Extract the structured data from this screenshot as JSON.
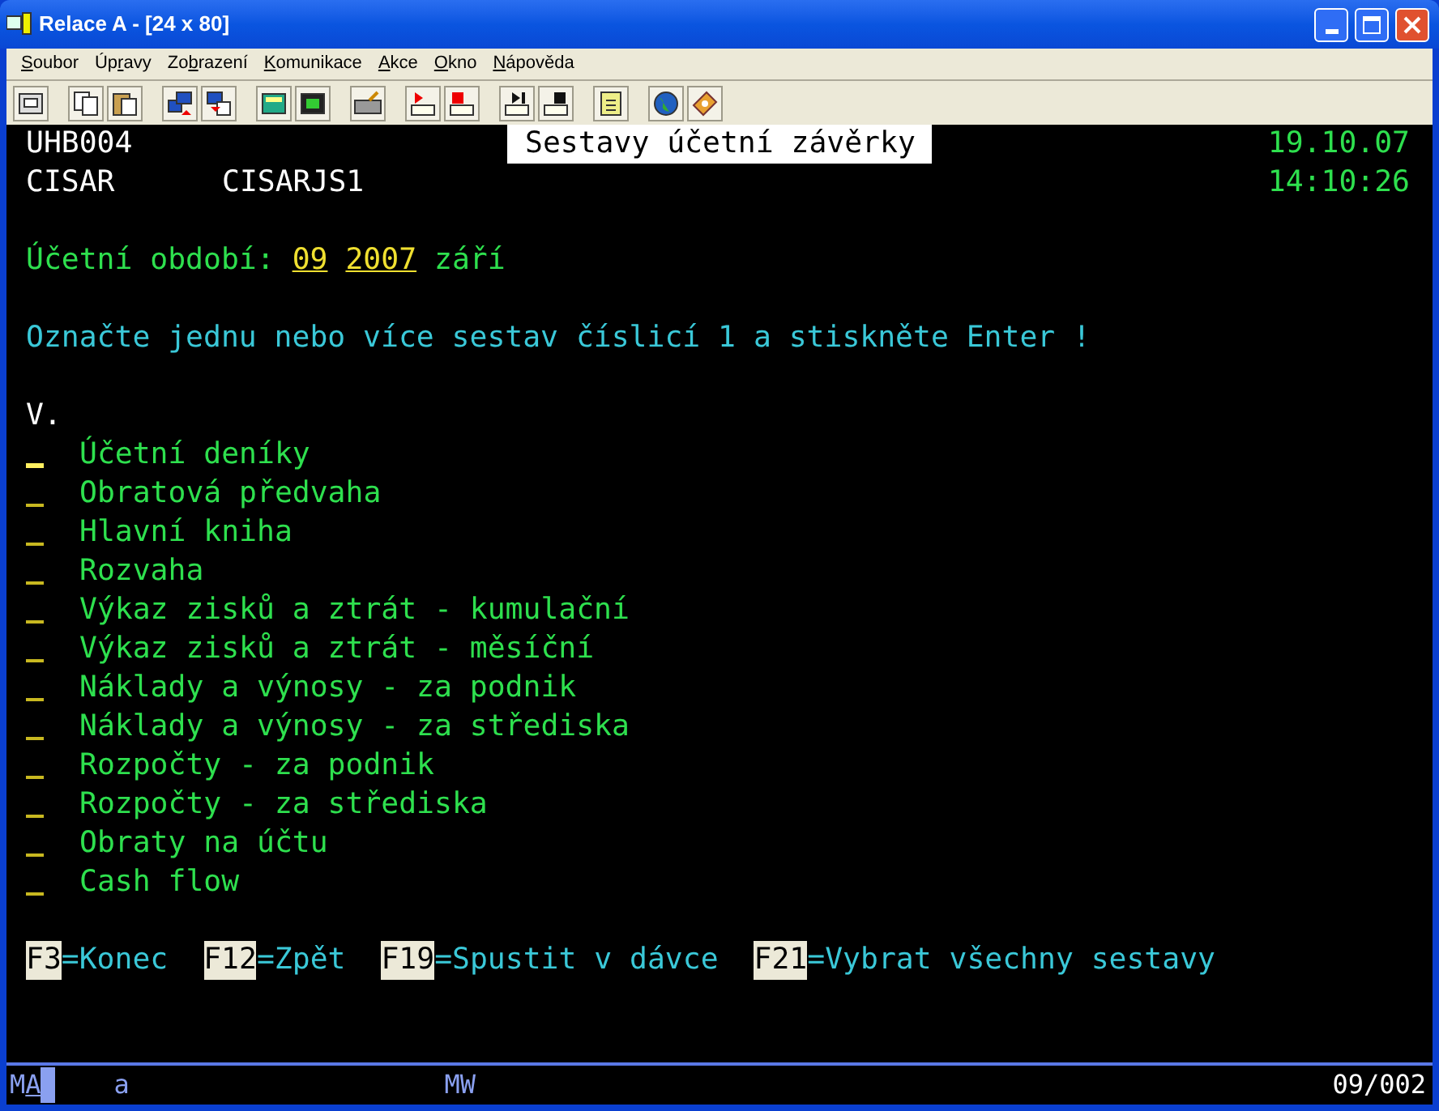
{
  "window": {
    "title": "Relace A - [24 x 80]"
  },
  "menu": [
    {
      "hotkey": "S",
      "after": "oubor"
    },
    {
      "before": "Úp",
      "hotkey": "r",
      "after": "avy"
    },
    {
      "before": "Zo",
      "hotkey": "b",
      "after": "razení"
    },
    {
      "hotkey": "K",
      "after": "omunikace"
    },
    {
      "hotkey": "A",
      "after": "kce"
    },
    {
      "hotkey": "O",
      "after": "kno"
    },
    {
      "hotkey": "N",
      "after": "ápověda"
    }
  ],
  "screen": {
    "program": "UHB004",
    "title": "Sestavy účetní závěrky",
    "date": "19.10.07",
    "user": "CISAR",
    "job": "CISARJS1",
    "time": "14:10:26",
    "period": {
      "label": "Účetní období:",
      "month": "09",
      "year": "2007",
      "month_name": "září"
    },
    "instruction": "Označte jednu nebo více sestav číslicí 1 a stiskněte Enter !",
    "column_header": "V.",
    "reports": [
      {
        "name": "Účetní deníky",
        "focused": true
      },
      {
        "name": "Obratová předvaha",
        "focused": false
      },
      {
        "name": "Hlavní kniha",
        "focused": false
      },
      {
        "name": "Rozvaha",
        "focused": false
      },
      {
        "name": "Výkaz zisků a ztrát - kumulační",
        "focused": false
      },
      {
        "name": "Výkaz zisků a ztrát - měsíční",
        "focused": false
      },
      {
        "name": "Náklady a výnosy - za podnik",
        "focused": false
      },
      {
        "name": "Náklady a výnosy - za střediska",
        "focused": false
      },
      {
        "name": "Rozpočty - za podnik",
        "focused": false
      },
      {
        "name": "Rozpočty - za střediska",
        "focused": false
      },
      {
        "name": "Obraty na účtu",
        "focused": false
      },
      {
        "name": "Cash flow",
        "focused": false
      }
    ],
    "function_keys": [
      {
        "key": "F3",
        "label": "=Konec"
      },
      {
        "key": "F12",
        "label": "=Zpět"
      },
      {
        "key": "F19",
        "label": "=Spustit v dávce"
      },
      {
        "key": "F21",
        "label": "=Vybrat všechny sestavy"
      }
    ]
  },
  "status_bar": {
    "mode": "M",
    "mode_flag": "A",
    "input": "a",
    "indicator": "MW",
    "position": "09/002"
  }
}
